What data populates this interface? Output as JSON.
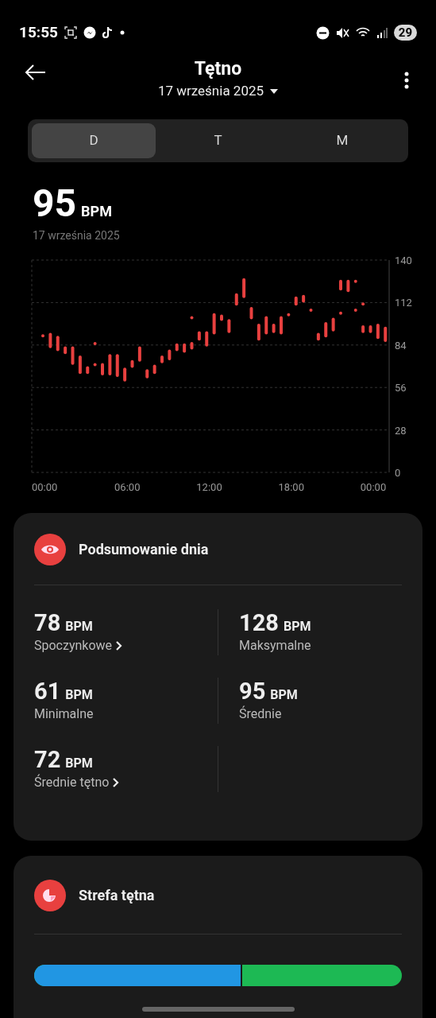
{
  "status_bar": {
    "time": "15:55",
    "battery": "29"
  },
  "header": {
    "title": "Tętno",
    "date": "17 września 2025"
  },
  "tabs": [
    {
      "label": "D",
      "selected": true
    },
    {
      "label": "T",
      "selected": false
    },
    {
      "label": "M",
      "selected": false
    }
  ],
  "current": {
    "value": "95",
    "unit": "BPM",
    "date": "17 września 2025"
  },
  "chart": {
    "y_labels": [
      "140",
      "112",
      "84",
      "56",
      "28",
      "0"
    ],
    "x_labels": [
      "00:00",
      "06:00",
      "12:00",
      "18:00",
      "00:00"
    ]
  },
  "summary": {
    "title": "Podsumowanie dnia",
    "stats": [
      {
        "value": "78",
        "unit": "BPM",
        "label": "Spoczynkowe",
        "has_arrow": true
      },
      {
        "value": "128",
        "unit": "BPM",
        "label": "Maksymalne",
        "has_arrow": false
      },
      {
        "value": "61",
        "unit": "BPM",
        "label": "Minimalne",
        "has_arrow": false
      },
      {
        "value": "95",
        "unit": "BPM",
        "label": "Średnie",
        "has_arrow": false
      },
      {
        "value": "72",
        "unit": "BPM",
        "label": "Średnie tętno",
        "has_arrow": true
      }
    ]
  },
  "zones": {
    "title": "Strefa tętna",
    "level": 0.565
  }
}
